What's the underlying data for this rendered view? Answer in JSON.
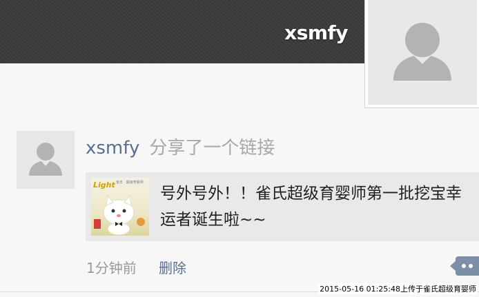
{
  "header": {
    "username": "xsmfy"
  },
  "feed": {
    "username": "xsmfy",
    "action": "分享了一个链接",
    "link": {
      "title": "号外号外！！雀氏超级育婴师第一批挖宝幸运者诞生啦~~",
      "thumbnail": {
        "brand": "Light",
        "small_text": "雀氏 · 超级育婴师"
      }
    },
    "time": "1分钟前",
    "delete_label": "删除"
  },
  "watermark": "2015-05-16 01:25:48上传于雀氏超级育婴师",
  "colors": {
    "cover_bg": "#3b3b3b",
    "link_blue": "#5a6f8f",
    "more_button": "#7c8fa6"
  },
  "icons": {
    "avatar": "person-silhouette-icon",
    "more": "more-dots-icon"
  }
}
